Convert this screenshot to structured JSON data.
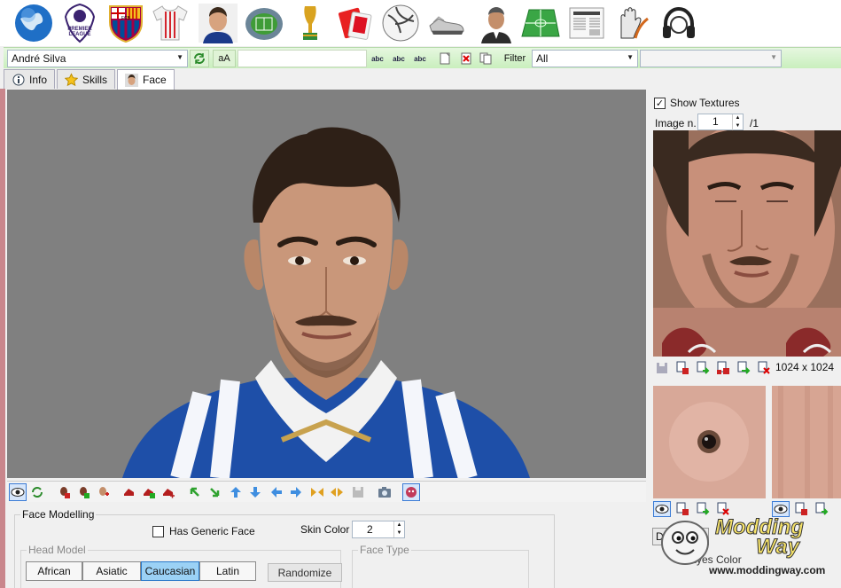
{
  "toolbar_icons": [
    {
      "name": "globe-icon"
    },
    {
      "name": "premier-league-icon"
    },
    {
      "name": "club-crest-icon"
    },
    {
      "name": "kit-icon"
    },
    {
      "name": "player-icon"
    },
    {
      "name": "stadium-icon"
    },
    {
      "name": "trophy-icon"
    },
    {
      "name": "referee-card-icon"
    },
    {
      "name": "ball-icon"
    },
    {
      "name": "boots-icon"
    },
    {
      "name": "manager-icon"
    },
    {
      "name": "pitch-icon"
    },
    {
      "name": "newspaper-icon"
    },
    {
      "name": "gloves-icon"
    },
    {
      "name": "headphones-icon"
    }
  ],
  "toolbar_icon_texts": {
    "premier_line1": "PREMIER",
    "premier_line2": "LEAGUE",
    "crest": "FCB"
  },
  "search": {
    "player_name": "André Silva",
    "case_button": "aA",
    "abc_label": "abc",
    "filter_label": "Filter",
    "filter_value": "All",
    "extra_value": ""
  },
  "tabs": [
    {
      "label": "Info",
      "icon": "info-icon",
      "active": false
    },
    {
      "label": "Skills",
      "icon": "star-icon",
      "active": false
    },
    {
      "label": "Face",
      "icon": "face-icon",
      "active": true
    }
  ],
  "face_modelling": {
    "title": "Face Modelling",
    "has_generic_face_label": "Has Generic Face",
    "has_generic_face": false,
    "skin_color_label": "Skin Color",
    "skin_color_value": "2",
    "head_model_label": "Head Model",
    "head_models": [
      {
        "label": "African",
        "selected": false
      },
      {
        "label": "Asiatic",
        "selected": false
      },
      {
        "label": "Caucasian",
        "selected": true
      },
      {
        "label": "Latin",
        "selected": false
      }
    ],
    "randomize_label": "Randomize",
    "face_type_label": "Face Type"
  },
  "textures": {
    "show_textures_label": "Show Textures",
    "show_textures": true,
    "image_n_label": "Image n.",
    "image_n_value": "1",
    "image_total": "/1",
    "texture_size": "1024 x 1024",
    "dark_button_label": "Dark Skin",
    "eyes_color_label": "Eyes Color"
  },
  "watermark": {
    "brand_line1": "Modding",
    "brand_line2": "Way",
    "url": "www.moddingway.com"
  },
  "colors": {
    "toolbar_green": "#c9efbd",
    "viewport_bg": "#808080",
    "selected_blue": "#9bd1f5",
    "left_accent": "#c9868c"
  }
}
